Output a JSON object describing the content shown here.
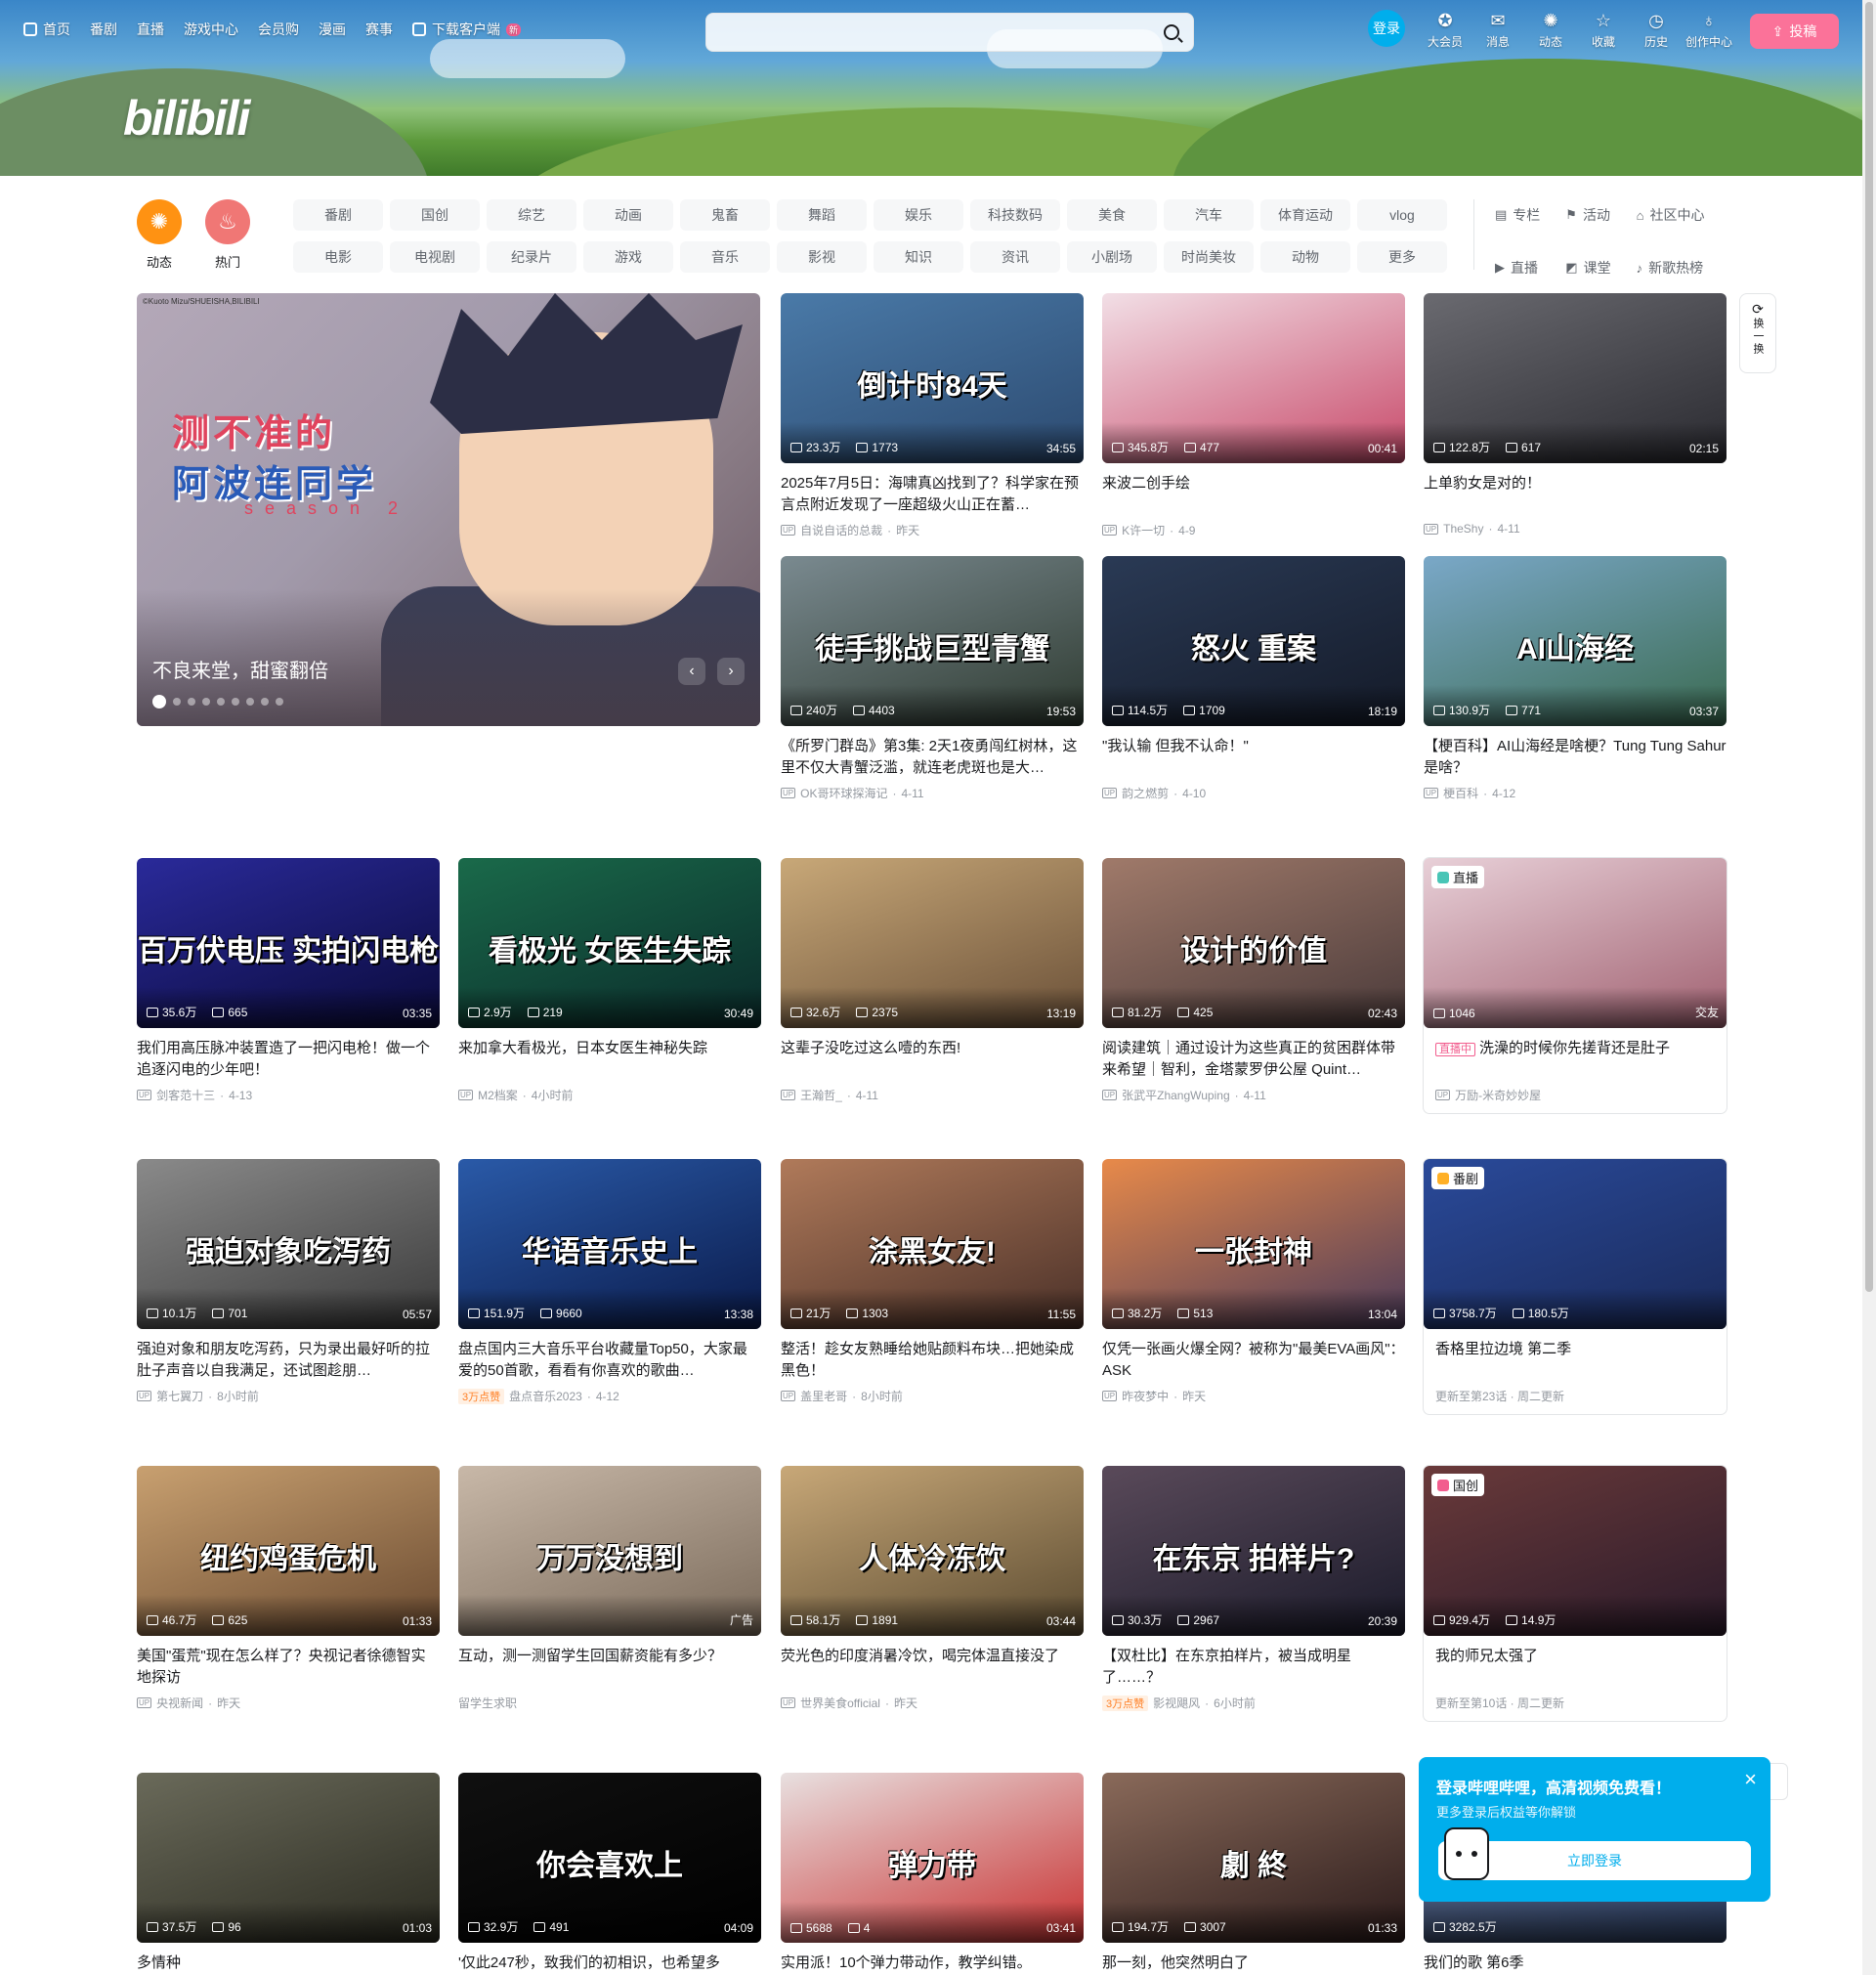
{
  "topnav": [
    {
      "label": "首页",
      "icon": "tv-icon"
    },
    {
      "label": "番剧"
    },
    {
      "label": "直播"
    },
    {
      "label": "游戏中心"
    },
    {
      "label": "会员购"
    },
    {
      "label": "漫画"
    },
    {
      "label": "赛事"
    },
    {
      "label": "下载客户端",
      "icon": "download-icon",
      "badge": "新"
    }
  ],
  "search": {
    "placeholder": ""
  },
  "logo_text": "bilibili",
  "user": {
    "login_label": "登录"
  },
  "rightnav": [
    {
      "label": "大会员",
      "icon": "vip-icon",
      "glyph": "✪"
    },
    {
      "label": "消息",
      "icon": "mail-icon",
      "glyph": "✉"
    },
    {
      "label": "动态",
      "icon": "wind-icon",
      "glyph": "✺"
    },
    {
      "label": "收藏",
      "icon": "star-icon",
      "glyph": "☆"
    },
    {
      "label": "历史",
      "icon": "clock-icon",
      "glyph": "◷"
    },
    {
      "label": "创作中心",
      "icon": "bulb-icon",
      "glyph": "♁"
    }
  ],
  "upload_label": "投稿",
  "channels_big": [
    {
      "label": "动态",
      "color": "#ff9212",
      "glyph": "✺"
    },
    {
      "label": "热门",
      "color": "#f07775",
      "glyph": "♨"
    }
  ],
  "channels": [
    "番剧",
    "国创",
    "综艺",
    "动画",
    "鬼畜",
    "舞蹈",
    "娱乐",
    "科技数码",
    "美食",
    "汽车",
    "体育运动",
    "vlog",
    "电影",
    "电视剧",
    "纪录片",
    "游戏",
    "音乐",
    "影视",
    "知识",
    "资讯",
    "小剧场",
    "时尚美妆",
    "动物",
    "更多"
  ],
  "channels_right": [
    {
      "label": "专栏",
      "glyph": "▤"
    },
    {
      "label": "活动",
      "glyph": "⚑"
    },
    {
      "label": "社区中心",
      "glyph": "⌂"
    },
    {
      "label": "直播",
      "glyph": "▶"
    },
    {
      "label": "课堂",
      "glyph": "◩"
    },
    {
      "label": "新歌热榜",
      "glyph": "♪"
    }
  ],
  "carousel": {
    "caption": "不良来堂，甜蜜翻倍",
    "art_title_1": "测不准的",
    "art_title_2": "阿波连同学",
    "art_title_3": "season 2",
    "copyright": "©Kuoto Mizu/SHUEISHA,BILIBILI",
    "prev": "‹",
    "next": "›",
    "dot_count": 9,
    "active_dot": 0
  },
  "refresh_label": "换一换",
  "cards": [
    {
      "title": "2025年7月5日：海啸真凶找到了？科学家在预言点附近发现了一座超级火山正在蓄…",
      "plays": "23.3万",
      "danmaku": "1773",
      "duration": "34:55",
      "author": "自说自话的总裁",
      "date": "昨天",
      "overlay": "倒计时84天",
      "c1": "#4a7aa8",
      "c2": "#2c4a70"
    },
    {
      "title": "来波二创手绘",
      "plays": "345.8万",
      "danmaku": "477",
      "duration": "00:41",
      "author": "K许一切",
      "date": "4-9",
      "c1": "#f2dfe6",
      "c2": "#c84a6a"
    },
    {
      "title": "上单豹女是对的！",
      "plays": "122.8万",
      "danmaku": "617",
      "duration": "02:15",
      "author": "TheShy",
      "date": "4-11",
      "c1": "#6a6a70",
      "c2": "#2a2a30"
    },
    {
      "title": "《所罗门群岛》第3集: 2天1夜勇闯红树林，这里不仅大青蟹泛滥，就连老虎斑也是大…",
      "plays": "240万",
      "danmaku": "4403",
      "duration": "19:53",
      "author": "OK哥环球探海记",
      "date": "4-11",
      "overlay": "徒手挑战巨型青蟹",
      "c1": "#7a8a90",
      "c2": "#2e3a30"
    },
    {
      "title": "\"我认输 但我不认命！\"",
      "plays": "114.5万",
      "danmaku": "1709",
      "duration": "18:19",
      "author": "韵之燃剪",
      "date": "4-10",
      "overlay": "怒火 重案",
      "c1": "#2a3a55",
      "c2": "#141a28"
    },
    {
      "title": "【梗百科】AI山海经是啥梗？Tung Tung Sahur是啥？",
      "plays": "130.9万",
      "danmaku": "771",
      "duration": "03:37",
      "author": "梗百科",
      "date": "4-12",
      "overlay": "AI山海经",
      "c1": "#7aa8c8",
      "c2": "#3a6a50"
    },
    {
      "title": "我们用高压脉冲装置造了一把闪电枪！做一个追逐闪电的少年吧！",
      "plays": "35.6万",
      "danmaku": "665",
      "duration": "03:35",
      "author": "剑客范十三",
      "date": "4-13",
      "overlay": "百万伏电压 实拍闪电枪",
      "c1": "#2a2a9a",
      "c2": "#0a0a3a"
    },
    {
      "title": "来加拿大看极光，日本女医生神秘失踪",
      "plays": "2.9万",
      "danmaku": "219",
      "duration": "30:49",
      "author": "M2档案",
      "date": "4小时前",
      "overlay": "看极光 女医生失踪",
      "c1": "#1a6a4a",
      "c2": "#0a2a2a"
    },
    {
      "title": "这辈子没吃过这么噎的东西!",
      "plays": "32.6万",
      "danmaku": "2375",
      "duration": "13:19",
      "author": "王瀚哲_",
      "date": "4-11",
      "c1": "#c8a878",
      "c2": "#6a5038"
    },
    {
      "title": "阅读建筑｜通过设计为这些真正的贫困群体带来希望｜智利，金塔蒙罗伊公屋 Quint…",
      "plays": "81.2万",
      "danmaku": "425",
      "duration": "02:43",
      "author": "张武平ZhangWuping",
      "date": "4-11",
      "overlay": "设计的价值",
      "c1": "#a07a6a",
      "c2": "#4a3a3a"
    },
    {
      "title": "洗澡的时候你先搓背还是肚子",
      "plays": "1046",
      "danmaku": "",
      "duration": "交友",
      "author": "万励-米奇妙妙屋",
      "date": "",
      "live": true,
      "tag": "直播",
      "tagcolor": "#49c5b6",
      "c1": "#e8d0d8",
      "c2": "#a06070"
    },
    {
      "title": "强迫对象和朋友吃泻药，只为录出最好听的拉肚子声音以自我满足，还试图趁朋…",
      "plays": "10.1万",
      "danmaku": "701",
      "duration": "05:57",
      "author": "第七翼刀",
      "date": "8小时前",
      "overlay": "强迫对象吃泻药",
      "c1": "#8a8a8a",
      "c2": "#3a3a3a"
    },
    {
      "title": "盘点国内三大音乐平台收藏量Top50，大家最爱的50首歌，看看有你喜欢的歌曲…",
      "plays": "151.9万",
      "danmaku": "9660",
      "duration": "13:38",
      "author": "盘点音乐2023",
      "date": "4-12",
      "badge": "3万点赞",
      "overlay": "华语音乐史上",
      "c1": "#2a5aa8",
      "c2": "#0a1a4a"
    },
    {
      "title": "整活！趁女友熟睡给她贴颜料布块…把她染成黑色！",
      "plays": "21万",
      "danmaku": "1303",
      "duration": "11:55",
      "author": "盖里老哥",
      "date": "8小时前",
      "overlay": "涂黑女友!",
      "c1": "#b07a5a",
      "c2": "#4a3028"
    },
    {
      "title": "仅凭一张画火爆全网？被称为\"最美EVA画风\"： ASK",
      "plays": "38.2万",
      "danmaku": "513",
      "duration": "13:04",
      "author": "昨夜梦中",
      "date": "昨天",
      "overlay": "一张封神",
      "c1": "#e88a4a",
      "c2": "#4a3a5a"
    },
    {
      "title": "香格里拉边境 第二季",
      "plays": "3758.7万",
      "danmaku": "180.5万",
      "duration": "",
      "author": "",
      "date": "",
      "sub": "更新至第23话 · 周二更新",
      "tag": "番剧",
      "tagcolor": "#ffb027",
      "c1": "#2a4a9a",
      "c2": "#1a2a5a"
    },
    {
      "title": "美国\"蛋荒\"现在怎么样了？央视记者徐德智实地探访",
      "plays": "46.7万",
      "danmaku": "625",
      "duration": "01:33",
      "author": "央视新闻",
      "date": "昨天",
      "overlay": "纽约鸡蛋危机",
      "c1": "#c8a070",
      "c2": "#6a4a30"
    },
    {
      "title": "互动，测一测留学生回国薪资能有多少？",
      "plays": "",
      "danmaku": "",
      "duration": "广告",
      "author": "留学生求职",
      "date": "",
      "ad": true,
      "overlay": "万万没想到",
      "c1": "#c8b8a8",
      "c2": "#7a6a5a"
    },
    {
      "title": "荧光色的印度消暑冷饮，喝完体温直接没了",
      "plays": "58.1万",
      "danmaku": "1891",
      "duration": "03:44",
      "author": "世界美食official",
      "date": "昨天",
      "overlay": "人体冷冻饮",
      "c1": "#c8a878",
      "c2": "#5a4a30"
    },
    {
      "title": "【双杜比】在东京拍样片，被当成明星了……？",
      "plays": "30.3万",
      "danmaku": "2967",
      "duration": "20:39",
      "author": "影视飓风",
      "date": "6小时前",
      "badge": "3万点赞",
      "overlay": "在东京 拍样片?",
      "c1": "#5a4a5a",
      "c2": "#1a1a2a"
    },
    {
      "title": "我的师兄太强了",
      "plays": "929.4万",
      "danmaku": "14.9万",
      "duration": "",
      "author": "",
      "date": "",
      "sub": "更新至第10话 · 周二更新",
      "tag": "国创",
      "tagcolor": "#f25d8e",
      "c1": "#6a3a3a",
      "c2": "#2a1a2a"
    },
    {
      "title": "多情种",
      "plays": "37.5万",
      "danmaku": "96",
      "duration": "01:03",
      "author": "",
      "date": "",
      "c1": "#6a6a5a",
      "c2": "#2a2a20"
    },
    {
      "title": "'仅此247秒，致我们的初相识，也希望多",
      "plays": "32.9万",
      "danmaku": "491",
      "duration": "04:09",
      "author": "",
      "date": "",
      "overlay": "你会喜欢上",
      "c1": "#101010",
      "c2": "#000000"
    },
    {
      "title": "实用派！10个弹力带动作，教学纠错。",
      "plays": "5688",
      "danmaku": "4",
      "duration": "03:41",
      "author": "",
      "date": "",
      "overlay": "弹力带",
      "c1": "#e8e0e0",
      "c2": "#c83030"
    },
    {
      "title": "那一刻，他突然明白了",
      "plays": "194.7万",
      "danmaku": "3007",
      "duration": "01:33",
      "author": "",
      "date": "",
      "overlay": "劇 終",
      "c1": "#8a6a5a",
      "c2": "#2a1a1a"
    },
    {
      "title": "我们的歌 第6季",
      "plays": "3282.5万",
      "danmaku": "",
      "duration": "",
      "author": "",
      "date": "",
      "c1": "#5a6a8a",
      "c2": "#2a3a5a"
    }
  ],
  "popup": {
    "heading": "登录哔哩哔哩，高清视频免费看！",
    "sub": "更多登录后权益等你解锁",
    "button": "立即登录",
    "close": "×"
  }
}
